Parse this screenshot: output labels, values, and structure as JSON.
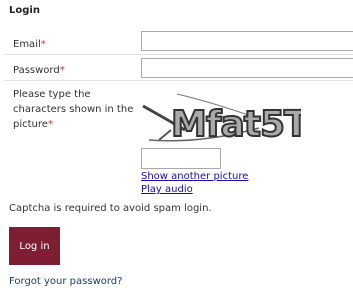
{
  "form": {
    "heading": "Login",
    "email": {
      "label": "Email",
      "required_mark": "*",
      "value": ""
    },
    "password": {
      "label": "Password",
      "required_mark": "*",
      "value": ""
    },
    "captcha": {
      "label": "Please type the characters shown in the picture",
      "required_mark": "*",
      "image_text": "Mfat5T",
      "value": "",
      "show_another_label": "Show another picture",
      "play_audio_label": "Play audio"
    },
    "note": "Captcha is required to avoid spam login.",
    "submit_label": "Log in",
    "forgot_label": "Forgot your password?"
  },
  "colors": {
    "button_bg": "#7d1e33",
    "required_mark": "#c0392b",
    "link": "#1a0dab"
  }
}
